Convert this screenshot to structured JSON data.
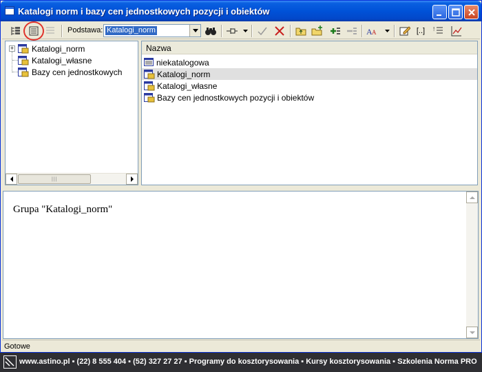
{
  "window": {
    "title": "Katalogi norm i bazy cen jednostkowych pozycji i obiektów"
  },
  "toolbar": {
    "podstawa_label": "Podstawa:",
    "podstawa_value": "Katalogi_norm",
    "bracket_label": "[..]"
  },
  "tree": {
    "items": [
      {
        "label": "Katalogi_norm"
      },
      {
        "label": "Katalogi_własne"
      },
      {
        "label": "Bazy cen jednostkowych"
      }
    ]
  },
  "list": {
    "header": "Nazwa",
    "rows": [
      {
        "label": "niekatalogowa",
        "icon": "table-icon"
      },
      {
        "label": "Katalogi_norm",
        "icon": "catalog-icon"
      },
      {
        "label": "Katalogi_własne",
        "icon": "catalog-icon"
      },
      {
        "label": "Bazy cen jednostkowych pozycji i obiektów",
        "icon": "catalog-icon"
      }
    ]
  },
  "details": {
    "text": "Grupa \"Katalogi_norm\""
  },
  "status": {
    "text": "Gotowe"
  },
  "footer": {
    "text": "www.astino.pl  ▪  (22) 8 555 404  ▪  (52) 327 27 27  ▪  Programy do kosztorysowania  ▪  Kursy kosztorysowania  ▪  Szkolenia Norma PRO"
  },
  "colors": {
    "titlebar": "#0052d8",
    "selection": "#316ac5",
    "highlight_circle": "#e0332b"
  }
}
